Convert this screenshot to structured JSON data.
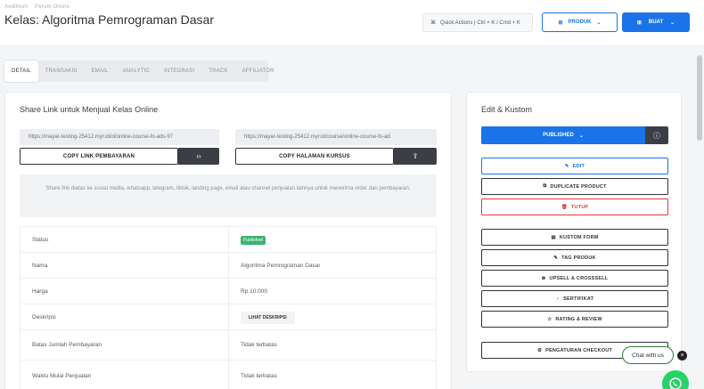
{
  "breadcrumb": [
    "Aedillium",
    "Perum Online"
  ],
  "page_title": "Kelas: Algoritma Pemrograman Dasar",
  "header": {
    "quick_actions": "Quick Actions | Ctrl + K / Cmd + K",
    "produk_label": "PRODUK",
    "buat_label": "BUAT"
  },
  "tabs": [
    {
      "label": "DETAIL",
      "active": true
    },
    {
      "label": "TRANSAKSI",
      "active": false
    },
    {
      "label": "EMAIL",
      "active": false
    },
    {
      "label": "ANALYTIC",
      "active": false
    },
    {
      "label": "INTEGRASI",
      "active": false
    },
    {
      "label": "TRACK",
      "active": false
    },
    {
      "label": "AFFILIATOR",
      "active": false
    }
  ],
  "share": {
    "title": "Share Link untuk Menjual Kelas Online",
    "link1": "https://mayar-testing-25412.myr.id/ol/online-course-fo-ads-97",
    "link2": "https://mayar-testing-25412.myr.id/course/online-course-fo-ad",
    "copy1_label": "COPY LINK PEMBAYARAN",
    "copy2_label": "COPY HALAMAN KURSUS",
    "info": "Share link diatas ke sosial media, whatsapp, telegram, tiktok, landing page, email atau channel penjualan lainnya untuk menerima order dan pembayaran."
  },
  "details": {
    "status_label": "Status",
    "status_value": "Published",
    "nama_label": "Nama",
    "nama_value": "Algoritma Pemrograman Dasar",
    "harga_label": "Harga",
    "harga_value": "Rp 10.000",
    "deskripsi_label": "Deskripsi",
    "deskripsi_button": "LIHAT DESKRIPSI",
    "batas_label": "Batas Jumlah Pembayaran",
    "batas_value": "Tidak terbatas",
    "waktu_label": "Waktu Mulai Penjualan",
    "waktu_value": "Tidak terbatas"
  },
  "edit": {
    "title": "Edit & Kustom",
    "published_label": "PUBLISHED",
    "edit_label": "EDIT",
    "duplicate_label": "DUPLICATE PRODUCT",
    "tutup_label": "TUTUP",
    "kustom_label": "KUSTOM FORM",
    "tag_label": "TAG PRODUK",
    "upsell_label": "UPSELL & CROSSSELL",
    "sertifikat_label": "SERTIFIKAT",
    "rating_label": "RATING & REVIEW",
    "checkout_label": "PENGATURAN CHECKOUT"
  },
  "chat": {
    "label": "Chat with us"
  },
  "colors": {
    "primary": "#1a73e8",
    "danger": "#e53935",
    "success": "#3cb371",
    "dark": "#3b3f45",
    "whatsapp": "#25d366"
  }
}
